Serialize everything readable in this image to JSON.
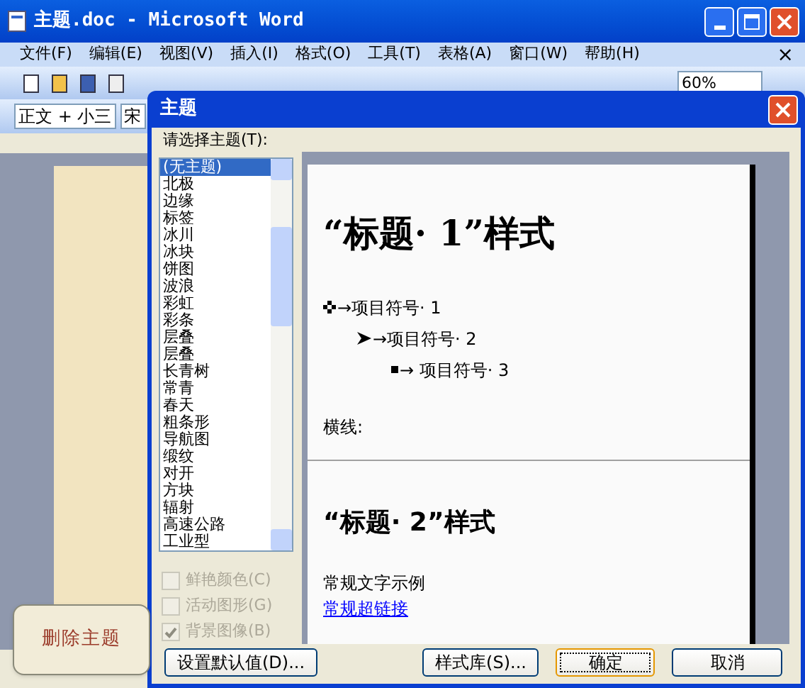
{
  "window": {
    "title": "主题.doc - Microsoft Word"
  },
  "menu": [
    {
      "label": "文件(F)"
    },
    {
      "label": "编辑(E)"
    },
    {
      "label": "视图(V)"
    },
    {
      "label": "插入(I)"
    },
    {
      "label": "格式(O)"
    },
    {
      "label": "工具(T)"
    },
    {
      "label": "表格(A)"
    },
    {
      "label": "窗口(W)"
    },
    {
      "label": "帮助(H)"
    }
  ],
  "menu_close": "×",
  "toolbar": {
    "zoom": "60%"
  },
  "format_toolbar": {
    "style": "正文 + 小三",
    "font": "宋"
  },
  "dialog": {
    "title": "主题",
    "prompt": "请选择主题(T):",
    "themes": [
      {
        "label": "(无主题)",
        "selected": true
      },
      {
        "label": "北极",
        "selected": false
      },
      {
        "label": "边缘",
        "selected": false
      },
      {
        "label": "标签",
        "selected": false
      },
      {
        "label": "冰川",
        "selected": false
      },
      {
        "label": "冰块",
        "selected": false
      },
      {
        "label": "饼图",
        "selected": false
      },
      {
        "label": "波浪",
        "selected": false
      },
      {
        "label": "彩虹",
        "selected": false
      },
      {
        "label": "彩条",
        "selected": false
      },
      {
        "label": "层叠",
        "selected": false
      },
      {
        "label": "层叠",
        "selected": false
      },
      {
        "label": "长青树",
        "selected": false
      },
      {
        "label": "常青",
        "selected": false
      },
      {
        "label": "春天",
        "selected": false
      },
      {
        "label": "粗条形",
        "selected": false
      },
      {
        "label": "导航图",
        "selected": false
      },
      {
        "label": "缎纹",
        "selected": false
      },
      {
        "label": "对开",
        "selected": false
      },
      {
        "label": "方块",
        "selected": false
      },
      {
        "label": "辐射",
        "selected": false
      },
      {
        "label": "高速公路",
        "selected": false
      },
      {
        "label": "工业型",
        "selected": false
      }
    ],
    "options": [
      {
        "label": "鲜艳颜色(C)",
        "checked": false,
        "disabled": true
      },
      {
        "label": "活动图形(G)",
        "checked": false,
        "disabled": true
      },
      {
        "label": "背景图像(B)",
        "checked": true,
        "disabled": true
      }
    ],
    "preview": {
      "heading1": "“标题· 1”样式",
      "bullets": [
        {
          "kind": "diamond",
          "text": "→项目符号· 1"
        },
        {
          "kind": "arrow",
          "text": "→项目符号· 2"
        },
        {
          "kind": "square",
          "text": "→ 项目符号· 3"
        }
      ],
      "rule_label": "横线:",
      "heading2": "“标题· 2”样式",
      "body_text": "常规文字示例",
      "link_text": "常规超链接"
    },
    "buttons": [
      {
        "label": "设置默认值(D)...",
        "default": false
      },
      {
        "label": "样式库(S)...",
        "default": false
      },
      {
        "label": "确定",
        "default": true
      },
      {
        "label": "取消",
        "default": false
      }
    ]
  },
  "callout": {
    "label": "删除主题"
  }
}
